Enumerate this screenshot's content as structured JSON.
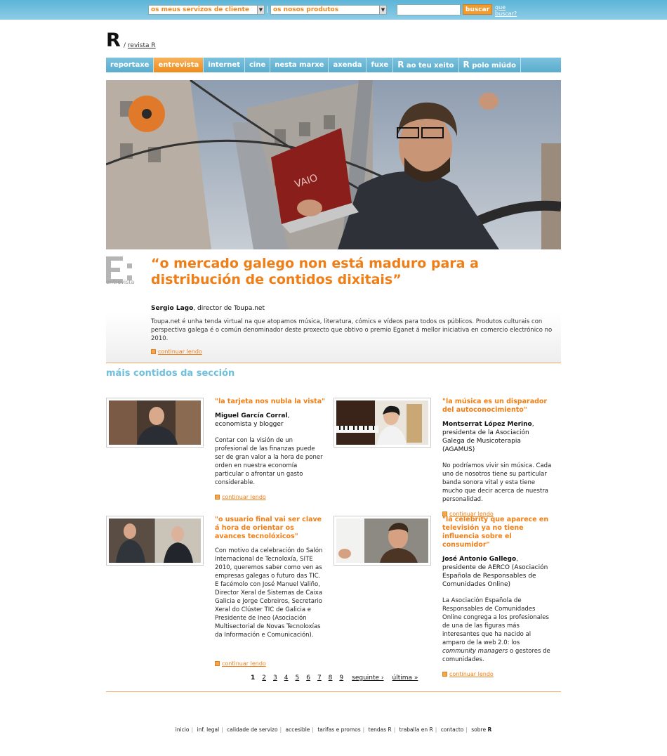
{
  "top": {
    "services_select": "os meus servizos de cliente",
    "products_select": "os nosos produtos",
    "search_button": "buscar",
    "help_link": "que buscar?"
  },
  "brand": {
    "logo": "R",
    "crumb": "revista R"
  },
  "nav": {
    "items": [
      {
        "label": "reportaxe"
      },
      {
        "label": "entrevista"
      },
      {
        "label": "internet"
      },
      {
        "label": "cine"
      },
      {
        "label": "nesta marxe"
      },
      {
        "label": "axenda"
      },
      {
        "label": "fuxe"
      },
      {
        "label": "ao teu xeito"
      },
      {
        "label": "polo miúdo"
      }
    ]
  },
  "feature": {
    "badge": "entrevista",
    "title": "“o mercado galego non está maduro para a distribución de contidos dixitais”",
    "author_name": "Sergio Lago",
    "author_role": ", director de Toupa.net",
    "body": "Toupa.net é unha tenda virtual na que atopamos música, literatura, cómics e vídeos para todos os públicos. Produtos culturais con perspectiva galega é o común denominador deste proxecto que obtivo o premio Eganet á mellor iniciativa en comercio electrónico no 2010.",
    "more": "continuar lendo"
  },
  "section_title": "máis contidos da sección",
  "articles": [
    {
      "title": "\"la tarjeta nos nubla la vista\"",
      "author_name": "Miguel García Corral",
      "author_role": ", economista y blogger",
      "body": "Contar con la visión de un profesional de las finanzas puede ser de gran valor a la hora de poner orden en nuestra economía particular o afrontar un gasto considerable.",
      "more": "continuar lendo"
    },
    {
      "title": "\"la música es un disparador del autoconocimiento\"",
      "author_name": "Montserrat López Merino",
      "author_role": ", presidenta de la Asociación Galega de Musicoterapia (AGAMUS)",
      "body": "No podríamos vivir sin música. Cada uno de nosotros tiene su particular banda sonora vital y esta tiene mucho que decir acerca de nuestra personalidad.",
      "more": "continuar lendo"
    },
    {
      "title": "\"o usuario final vai ser clave á hora de orientar os avances tecnolóxicos\"",
      "author_name": "",
      "author_role": "",
      "body": "Con motivo da celebración do Salón Internacional de Tecnoloxía, SITE 2010, queremos saber como ven as empresas galegas o futuro das TIC. E facémolo con José Manuel Valiño, Director Xeral de Sistemas de Caixa Galicia e Jorge Cebreiros, Secretario Xeral do Clúster TIC de Galicia e Presidente de Ineo (Asociación Multisectorial de Novas Tecnoloxías da Información e Comunicación).",
      "more": "continuar lendo"
    },
    {
      "title": "\"la celebrity que aparece en televisión ya no tiene influencia sobre el consumidor\"",
      "author_name": "José Antonio Gallego",
      "author_role": ", presidente de AERCO (Asociación Española de Responsables de Comunidades Online)",
      "body_pre": "La Asociación Española de Responsables de Comunidades Online congrega a los profesionales de una de las figuras más interesantes que ha nacido al amparo de la web 2.0: los ",
      "body_em": "community managers",
      "body_post": " o gestores de comunidades.",
      "more": "continuar lendo"
    }
  ],
  "pager": {
    "pages": [
      "1",
      "2",
      "3",
      "4",
      "5",
      "6",
      "7",
      "8",
      "9"
    ],
    "next": "seguinte ›",
    "last": "última »"
  },
  "footer": {
    "links": [
      "inicio",
      "inf. legal",
      "calidade de servizo",
      "accesible",
      "tarifas e promos",
      "tendas R",
      "traballa en R",
      "contacto",
      "sobre"
    ],
    "last_logo": "R"
  }
}
